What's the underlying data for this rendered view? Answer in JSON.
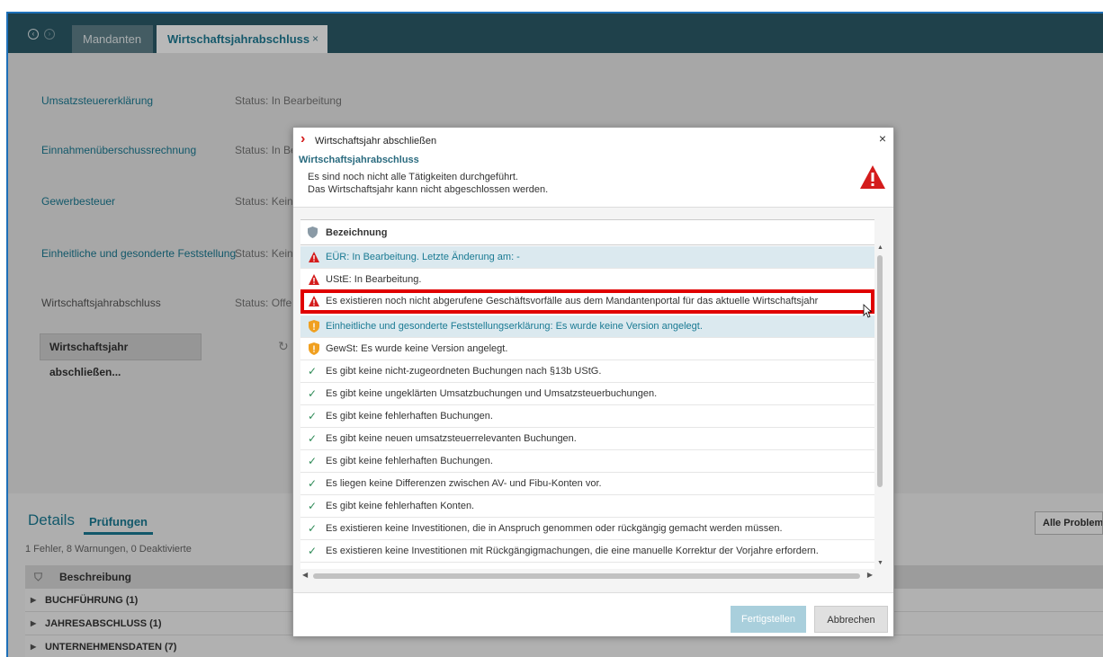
{
  "tabs": [
    {
      "label": "Mandanten"
    },
    {
      "label": "Wirtschaftsjahrabschluss",
      "close": "×"
    }
  ],
  "rows": [
    {
      "label": "Umsatzsteuererklärung",
      "status": "Status: In Bearbeitung"
    },
    {
      "label": "Einnahmenüberschussrechnung",
      "status": "Status: In Be"
    },
    {
      "label": "Gewerbesteuer",
      "status": "Status: Kein"
    },
    {
      "label": "Einheitliche und gesonderte Feststellung",
      "status": "Status: Kein"
    },
    {
      "label": "Wirtschaftsjahrabschluss",
      "status": "Status: Offe"
    }
  ],
  "close_year_button": "Wirtschaftsjahr abschließen...",
  "details": {
    "title": "Details",
    "tab": "Prüfungen",
    "count": "1 Fehler, 8 Warnungen, 0 Deaktivierte",
    "alle_button": "Alle Problem",
    "header": "Beschreibung",
    "groups": [
      "BUCHFÜHRUNG (1)",
      "JAHRESABSCHLUSS (1)",
      "UNTERNEHMENSDATEN (7)"
    ]
  },
  "dialog": {
    "title": "Wirtschaftsjahr abschließen",
    "close": "×",
    "subtitle": "Wirtschaftsjahrabschluss",
    "message_line1": "Es sind noch nicht alle Tätigkeiten durchgeführt.",
    "message_line2": "Das Wirtschaftsjahr kann nicht abgeschlossen werden.",
    "list_header": "Bezeichnung",
    "items": [
      {
        "icon": "error-triangle-icon",
        "text": "EÜR: In Bearbeitung. Letzte Änderung am: -"
      },
      {
        "icon": "error-triangle-icon",
        "text": "UStE: In Bearbeitung."
      },
      {
        "icon": "error-triangle-icon",
        "text": "Es existieren noch nicht abgerufene Geschäftsvorfälle aus dem Mandantenportal für das aktuelle Wirtschaftsjahr"
      },
      {
        "icon": "warning-shield-icon",
        "text": "Einheitliche und gesonderte Feststellungserklärung: Es wurde keine Version angelegt."
      },
      {
        "icon": "warning-shield-icon",
        "text": "GewSt: Es wurde keine Version angelegt."
      },
      {
        "icon": "check-icon",
        "text": "Es gibt keine nicht-zugeordneten Buchungen nach §13b UStG."
      },
      {
        "icon": "check-icon",
        "text": "Es gibt keine ungeklärten Umsatzbuchungen und Umsatzsteuerbuchungen."
      },
      {
        "icon": "check-icon",
        "text": "Es gibt keine fehlerhaften Buchungen."
      },
      {
        "icon": "check-icon",
        "text": "Es gibt keine neuen umsatzsteuerrelevanten Buchungen."
      },
      {
        "icon": "check-icon",
        "text": "Es gibt keine fehlerhaften Buchungen."
      },
      {
        "icon": "check-icon",
        "text": "Es liegen keine Differenzen zwischen AV- und Fibu-Konten vor."
      },
      {
        "icon": "check-icon",
        "text": "Es gibt keine fehlerhaften Konten."
      },
      {
        "icon": "check-icon",
        "text": "Es existieren keine Investitionen, die in Anspruch genommen oder rückgängig gemacht werden müssen."
      },
      {
        "icon": "check-icon",
        "text": "Es existieren keine Investitionen mit Rückgängigmachungen, die eine manuelle Korrektur der Vorjahre erfordern."
      }
    ],
    "button_finish": "Fertigstellen",
    "button_cancel": "Abbrechen"
  },
  "colors": {
    "accent": "#1a7a93",
    "topbar": "#2c5a68",
    "error": "#d41c1c",
    "warning": "#f0a020",
    "ok": "#2e8b57",
    "highlight": "#e00000"
  }
}
